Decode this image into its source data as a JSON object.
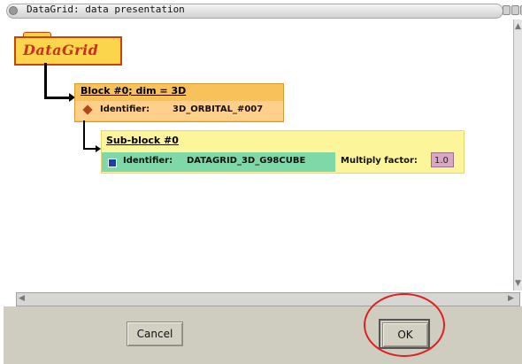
{
  "window": {
    "title": "DataGrid: data presentation"
  },
  "datagrid": {
    "label": "DataGrid"
  },
  "block": {
    "title": "Block #0;   dim = 3D",
    "identifier_label": "Identifier:",
    "identifier_value": "3D_ORBITAL_#007"
  },
  "subblock": {
    "title": "Sub-block #0",
    "identifier_label": "Identifier:",
    "identifier_value": "DATAGRID_3D_G98CUBE",
    "multiply_label": "Multiply factor:",
    "multiply_value": "1.0"
  },
  "buttons": {
    "cancel": "Cancel",
    "ok": "OK"
  },
  "icons": {
    "block": "diamond-icon",
    "subblock": "square-icon"
  },
  "colors": {
    "datagrid_bg": "#fbd54b",
    "block_bg": "#f8c15a",
    "subblock_bg": "#fdf59a",
    "identifier_bg": "#7fd8a8",
    "highlight": "#e02020"
  }
}
